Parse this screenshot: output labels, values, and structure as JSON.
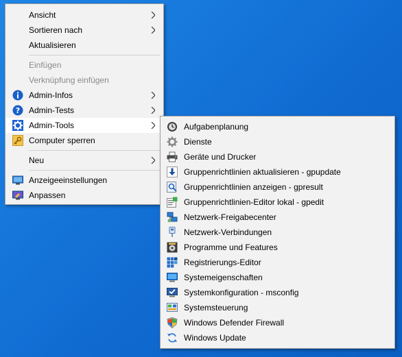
{
  "context_menu": {
    "items": [
      {
        "label": "Ansicht"
      },
      {
        "label": "Sortieren nach"
      },
      {
        "label": "Aktualisieren"
      },
      {
        "label": "Einfügen"
      },
      {
        "label": "Verknüpfung einfügen"
      },
      {
        "label": "Admin-Infos",
        "icon": "info-icon"
      },
      {
        "label": "Admin-Tests",
        "icon": "help-icon"
      },
      {
        "label": "Admin-Tools",
        "icon": "gear-icon"
      },
      {
        "label": "Computer sperren",
        "icon": "key-icon"
      },
      {
        "label": "Neu"
      },
      {
        "label": "Anzeigeeinstellungen",
        "icon": "display-icon"
      },
      {
        "label": "Anpassen",
        "icon": "personalize-icon"
      }
    ]
  },
  "admin_tools_submenu": {
    "items": [
      {
        "label": "Aufgabenplanung",
        "icon": "clock-icon"
      },
      {
        "label": "Dienste",
        "icon": "services-gear-icon"
      },
      {
        "label": "Geräte und Drucker",
        "icon": "printer-icon"
      },
      {
        "label": "Gruppenrichtlinien aktualisieren - gpupdate",
        "icon": "download-arrow-icon"
      },
      {
        "label": "Gruppenrichtlinien anzeigen - gpresult",
        "icon": "policy-view-icon"
      },
      {
        "label": "Gruppenrichtlinien-Editor lokal - gpedit",
        "icon": "policy-editor-icon"
      },
      {
        "label": "Netzwerk-Freigabecenter",
        "icon": "network-center-icon"
      },
      {
        "label": "Netzwerk-Verbindungen",
        "icon": "network-connections-icon"
      },
      {
        "label": "Programme und Features",
        "icon": "programs-icon"
      },
      {
        "label": "Registrierungs-Editor",
        "icon": "registry-icon"
      },
      {
        "label": "Systemeigenschaften",
        "icon": "monitor-icon"
      },
      {
        "label": "Systemkonfiguration - msconfig",
        "icon": "msconfig-icon"
      },
      {
        "label": "Systemsteuerung",
        "icon": "control-panel-icon"
      },
      {
        "label": "Windows Defender Firewall",
        "icon": "firewall-shield-icon"
      },
      {
        "label": "Windows Update",
        "icon": "update-arrows-icon"
      }
    ]
  },
  "colors": {
    "desktop": "#1573d8",
    "menu_bg": "#f2f2f2",
    "disabled_text": "#8a8a8a"
  }
}
